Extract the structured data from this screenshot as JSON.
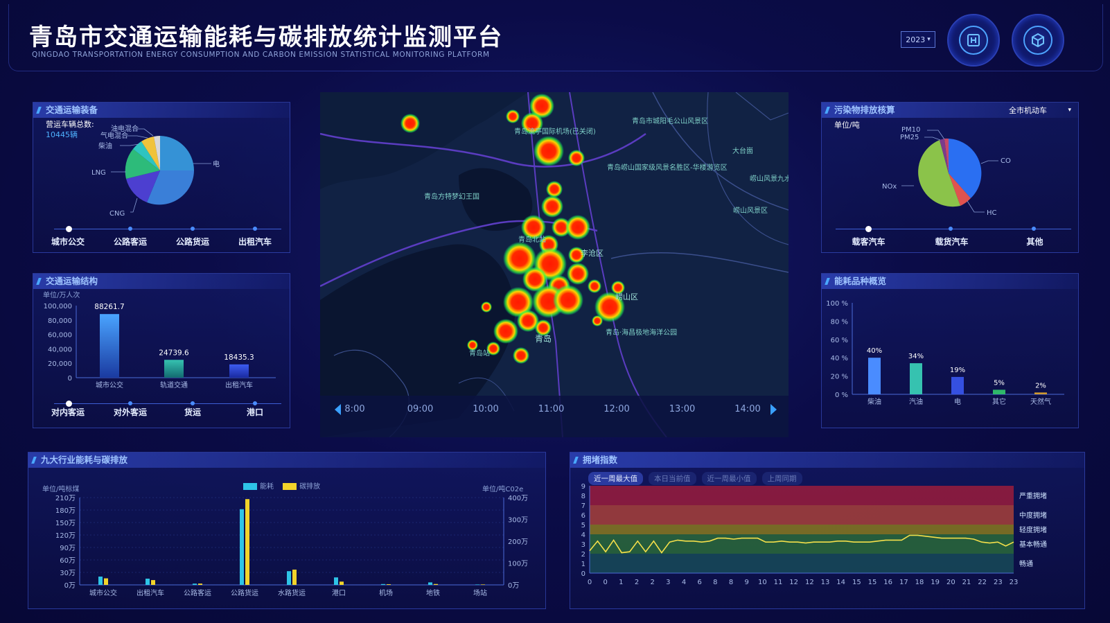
{
  "header": {
    "title": "青岛市交通运输能耗与碳排放统计监测平台",
    "subtitle": "QINGDAO TRANSPORTATION ENERGY CONSUMPTION AND CARBON EMISSION STATISTICAL MONITORING PLATFORM",
    "year": "2023",
    "buttons": [
      {
        "icon": "dashboard-icon"
      },
      {
        "icon": "cube-icon"
      }
    ]
  },
  "equipment": {
    "title": "交通运输装备",
    "total_label": "营运车辆总数:",
    "total_value": "10445辆",
    "tabs": [
      "城市公交",
      "公路客运",
      "公路货运",
      "出租汽车"
    ],
    "active_tab": 0,
    "pie_labels": {
      "oil_hybrid": "油电混合",
      "gas_hybrid": "气电混合",
      "diesel": "柴油",
      "lng": "LNG",
      "cng": "CNG",
      "electric": "电"
    }
  },
  "structure": {
    "title": "交通运输结构",
    "unit": "单位/万人次",
    "tabs": [
      "对内客运",
      "对外客运",
      "货运",
      "港口"
    ],
    "active_tab": 0,
    "y_ticks": [
      "100,000",
      "80,000",
      "60,000",
      "40,000",
      "20,000",
      "0"
    ],
    "bars": [
      {
        "label": "城市公交",
        "value": 88261.7,
        "value_text": "88261.7"
      },
      {
        "label": "轨道交通",
        "value": 24739.6,
        "value_text": "24739.6"
      },
      {
        "label": "出租汽车",
        "value": 18435.3,
        "value_text": "18435.3"
      }
    ]
  },
  "map": {
    "labels": [
      "青岛市城阳毛公山风景区",
      "青岛流亭国际机场(已关闭)",
      "大台崮",
      "青岛崂山国家级风景名胜区-华楼游览区",
      "崂山风景九水游",
      "青岛方特梦幻王国",
      "崂山风景区",
      "青岛北站",
      "李沧区",
      "崂山区",
      "青岛·海昌极地海洋公园",
      "青岛",
      "青岛站"
    ],
    "timeline": [
      "8:00",
      "09:00",
      "10:00",
      "11:00",
      "12:00",
      "13:00",
      "14:00"
    ]
  },
  "pollutant": {
    "title": "污染物排放核算",
    "dropdown": "全市机动车",
    "unit": "单位/吨",
    "pie_labels": {
      "pm10": "PM10",
      "pm25": "PM25",
      "co": "CO",
      "nox": "NOx",
      "hc": "HC"
    },
    "tabs": [
      "载客汽车",
      "载货汽车",
      "其他"
    ],
    "active_tab": 0
  },
  "energy_types": {
    "title": "能耗品种概览",
    "y_ticks": [
      "100 %",
      "80 %",
      "60 %",
      "40 %",
      "20 %",
      "0 %"
    ],
    "bars": [
      {
        "label": "柴油",
        "value": 40,
        "value_text": "40%"
      },
      {
        "label": "汽油",
        "value": 34,
        "value_text": "34%"
      },
      {
        "label": "电",
        "value": 19,
        "value_text": "19%"
      },
      {
        "label": "其它",
        "value": 5,
        "value_text": "5%"
      },
      {
        "label": "天然气",
        "value": 2,
        "value_text": "2%"
      }
    ]
  },
  "industry": {
    "title": "九大行业能耗与碳排放",
    "unit_left": "单位/吨标煤",
    "unit_right": "单位/吨C02e",
    "legend": [
      "能耗",
      "碳排放"
    ],
    "y_left": [
      "210万",
      "180万",
      "150万",
      "120万",
      "90万",
      "60万",
      "30万",
      "0万"
    ],
    "y_right": [
      "400万",
      "300万",
      "200万",
      "100万",
      "0万"
    ],
    "categories": [
      "城市公交",
      "出租汽车",
      "公路客运",
      "公路货运",
      "水路货运",
      "港口",
      "机场",
      "地铁",
      "场站"
    ],
    "energy_wan": [
      20,
      15,
      3,
      182,
      33,
      18,
      2,
      6,
      1
    ],
    "carbon_wan": [
      30,
      22,
      6,
      393,
      70,
      15,
      3,
      4,
      2
    ]
  },
  "congestion": {
    "title": "拥堵指数",
    "tabs": [
      "近一周最大值",
      "本日当前值",
      "近一周最小值",
      "上周同期"
    ],
    "active_tab": 0,
    "y_ticks": [
      "9",
      "8",
      "7",
      "6",
      "5",
      "4",
      "3",
      "2",
      "1",
      "0"
    ],
    "x_ticks": [
      "0",
      "0",
      "1",
      "2",
      "2",
      "3",
      "4",
      "6",
      "8",
      "8",
      "9",
      "10",
      "11",
      "12",
      "12",
      "13",
      "14",
      "15",
      "15",
      "16",
      "17",
      "18",
      "19",
      "20",
      "21",
      "22",
      "23",
      "23"
    ],
    "levels": [
      "严重拥堵",
      "中度拥堵",
      "轻度拥堵",
      "基本畅通",
      "畅通"
    ],
    "level_colors": [
      "#9a1c3c",
      "#a8413a",
      "#8a7a1e",
      "#2a6a3a",
      "#174a58"
    ]
  }
}
